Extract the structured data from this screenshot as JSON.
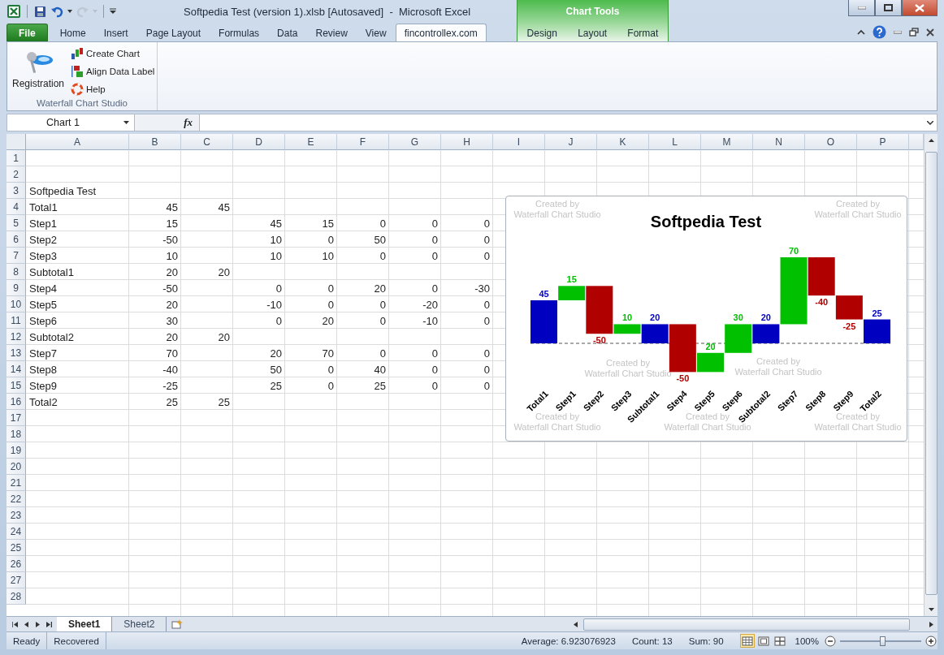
{
  "window": {
    "title": "Softpedia Test (version 1).xlsb [Autosaved]  -  Microsoft Excel"
  },
  "quick_access": [
    {
      "kind": "save",
      "disabled": false
    },
    {
      "kind": "undo",
      "disabled": false
    },
    {
      "kind": "redo",
      "disabled": true
    }
  ],
  "context_group": {
    "label": "Chart Tools"
  },
  "tabs": [
    {
      "label": "File",
      "kind": "file",
      "selected": false
    },
    {
      "label": "Home",
      "kind": "normal",
      "selected": false
    },
    {
      "label": "Insert",
      "kind": "normal",
      "selected": false
    },
    {
      "label": "Page Layout",
      "kind": "normal",
      "selected": false
    },
    {
      "label": "Formulas",
      "kind": "normal",
      "selected": false
    },
    {
      "label": "Data",
      "kind": "normal",
      "selected": false
    },
    {
      "label": "Review",
      "kind": "normal",
      "selected": false
    },
    {
      "label": "View",
      "kind": "normal",
      "selected": false
    },
    {
      "label": "fincontrollex.com",
      "kind": "normal",
      "selected": true
    },
    {
      "label": "Design",
      "kind": "contextual",
      "selected": false
    },
    {
      "label": "Layout",
      "kind": "contextual",
      "selected": false
    },
    {
      "label": "Format",
      "kind": "contextual",
      "selected": false
    }
  ],
  "ribbon": {
    "group": {
      "label": "Waterfall Chart Studio",
      "large_button": {
        "label": "Registration"
      },
      "buttons": [
        {
          "label": "Create Chart",
          "kind": "chart"
        },
        {
          "label": "Align Data Label",
          "kind": "align"
        },
        {
          "label": "Help",
          "kind": "help"
        }
      ]
    }
  },
  "formula_bar": {
    "name_box": "Chart 1",
    "function_label": "fx"
  },
  "sheet": {
    "columns": [
      "A",
      "B",
      "C",
      "D",
      "E",
      "F",
      "G",
      "H",
      "I",
      "J",
      "K",
      "L",
      "M",
      "N",
      "O",
      "P"
    ],
    "rows": [
      {
        "number": "1"
      },
      {
        "number": "2"
      },
      {
        "number": "3",
        "cells": {
          "A": "Softpedia Test"
        }
      },
      {
        "number": "4",
        "cells": {
          "A": "Total1",
          "B": "45",
          "C": "45"
        }
      },
      {
        "number": "5",
        "cells": {
          "A": "Step1",
          "B": "15",
          "D": "45",
          "E": "15",
          "F": "0",
          "G": "0",
          "H": "0"
        }
      },
      {
        "number": "6",
        "cells": {
          "A": "Step2",
          "B": "-50",
          "D": "10",
          "E": "0",
          "F": "50",
          "G": "0",
          "H": "0"
        }
      },
      {
        "number": "7",
        "cells": {
          "A": "Step3",
          "B": "10",
          "D": "10",
          "E": "10",
          "F": "0",
          "G": "0",
          "H": "0"
        }
      },
      {
        "number": "8",
        "cells": {
          "A": "Subtotal1",
          "B": "20",
          "C": "20"
        }
      },
      {
        "number": "9",
        "cells": {
          "A": "Step4",
          "B": "-50",
          "D": "0",
          "E": "0",
          "F": "20",
          "G": "0",
          "H": "-30"
        }
      },
      {
        "number": "10",
        "cells": {
          "A": "Step5",
          "B": "20",
          "D": "-10",
          "E": "0",
          "F": "0",
          "G": "-20",
          "H": "0"
        }
      },
      {
        "number": "11",
        "cells": {
          "A": "Step6",
          "B": "30",
          "D": "0",
          "E": "20",
          "F": "0",
          "G": "-10",
          "H": "0"
        }
      },
      {
        "number": "12",
        "cells": {
          "A": "Subtotal2",
          "B": "20",
          "C": "20"
        }
      },
      {
        "number": "13",
        "cells": {
          "A": "Step7",
          "B": "70",
          "D": "20",
          "E": "70",
          "F": "0",
          "G": "0",
          "H": "0"
        }
      },
      {
        "number": "14",
        "cells": {
          "A": "Step8",
          "B": "-40",
          "D": "50",
          "E": "0",
          "F": "40",
          "G": "0",
          "H": "0"
        }
      },
      {
        "number": "15",
        "cells": {
          "A": "Step9",
          "B": "-25",
          "D": "25",
          "E": "0",
          "F": "25",
          "G": "0",
          "H": "0"
        }
      },
      {
        "number": "16",
        "cells": {
          "A": "Total2",
          "B": "25",
          "C": "25"
        }
      },
      {
        "number": "17"
      },
      {
        "number": "18"
      },
      {
        "number": "19"
      },
      {
        "number": "20"
      },
      {
        "number": "21"
      },
      {
        "number": "22"
      },
      {
        "number": "23"
      },
      {
        "number": "24"
      },
      {
        "number": "25"
      },
      {
        "number": "26"
      },
      {
        "number": "27"
      },
      {
        "number": "28"
      }
    ]
  },
  "chart": {
    "title": "Softpedia Test",
    "bars": [
      {
        "category": "Total1",
        "label": "45",
        "kind": "total"
      },
      {
        "category": "Step1",
        "label": "15",
        "kind": "increase"
      },
      {
        "category": "Step2",
        "label": "-50",
        "kind": "decrease"
      },
      {
        "category": "Step3",
        "label": "10",
        "kind": "increase"
      },
      {
        "category": "Subtotal1",
        "label": "20",
        "kind": "total"
      },
      {
        "category": "Step4",
        "label": "-50",
        "kind": "decrease"
      },
      {
        "category": "Step5",
        "label": "20",
        "kind": "increase"
      },
      {
        "category": "Step6",
        "label": "30",
        "kind": "increase"
      },
      {
        "category": "Subtotal2",
        "label": "20",
        "kind": "total"
      },
      {
        "category": "Step7",
        "label": "70",
        "kind": "increase"
      },
      {
        "category": "Step8",
        "label": "-40",
        "kind": "decrease"
      },
      {
        "category": "Step9",
        "label": "-25",
        "kind": "decrease"
      },
      {
        "category": "Total2",
        "label": "25",
        "kind": "total"
      }
    ],
    "watermarks": [
      {
        "lines": [
          "Created by",
          "Waterfall Chart Studio"
        ]
      },
      {
        "lines": [
          "Created by",
          "Waterfall Chart Studio"
        ]
      },
      {
        "lines": [
          "Created by",
          "Waterfall Chart Studio"
        ]
      },
      {
        "lines": [
          "Created by",
          "Waterfall Chart Studio"
        ]
      },
      {
        "lines": [
          "Created by",
          "Waterfall Chart Studio"
        ]
      },
      {
        "lines": [
          "Created by",
          "Waterfall Chart Studio"
        ]
      },
      {
        "lines": [
          "Created by",
          "Waterfall Chart Studio"
        ]
      }
    ]
  },
  "sheets": [
    {
      "label": "Sheet1",
      "selected": true
    },
    {
      "label": "Sheet2",
      "selected": false
    }
  ],
  "status_bar": {
    "items": [
      "Ready",
      "Recovered"
    ],
    "summary": [
      "Average: 6.923076923",
      "Count: 13",
      "Sum: 90"
    ],
    "views": [
      {
        "kind": "normal",
        "selected": true
      },
      {
        "kind": "page_layout",
        "selected": false
      },
      {
        "kind": "page_break",
        "selected": false
      }
    ],
    "zoom": {
      "label": "100%",
      "level": 0.52
    }
  }
}
